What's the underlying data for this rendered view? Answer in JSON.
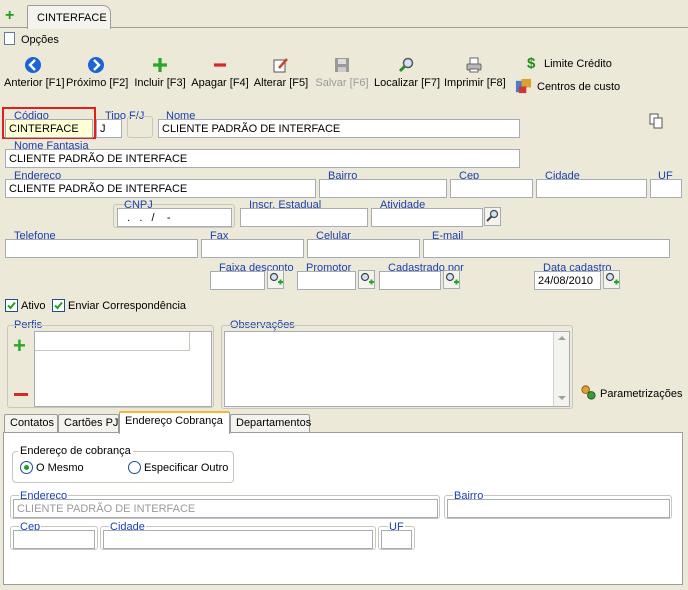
{
  "tab_title": "CINTERFACE",
  "menu": {
    "options": "Opções"
  },
  "toolbar": {
    "previous": "Anterior [F1]",
    "next": "Próximo [F2]",
    "add": "Incluir [F3]",
    "delete": "Apagar [F4]",
    "edit": "Alterar [F5]",
    "save": "Salvar [F6]",
    "find": "Localizar [F7]",
    "print": "Imprimir [F8]",
    "credit_limit": "Limite Crédito",
    "cost_centers": "Centros de custo"
  },
  "form": {
    "codigo": {
      "label": "Código",
      "value": "CINTERFACE"
    },
    "tipo": {
      "label": "Tipo F/J",
      "value": "J"
    },
    "nome": {
      "label": "Nome",
      "value": "CLIENTE PADRÃO DE INTERFACE"
    },
    "nome_fantasia": {
      "label": "Nome Fantasia",
      "value": "CLIENTE PADRÃO DE INTERFACE"
    },
    "endereco": {
      "label": "Endereço",
      "value": "CLIENTE PADRÃO DE INTERFACE"
    },
    "bairro": {
      "label": "Bairro",
      "value": ""
    },
    "cep": {
      "label": "Cep",
      "value": ""
    },
    "cidade": {
      "label": "Cidade",
      "value": ""
    },
    "uf": {
      "label": "UF",
      "value": ""
    },
    "cnpj": {
      "label": "CNPJ",
      "value": "  .   .   /    -  "
    },
    "inscr_estadual": {
      "label": "Inscr. Estadual",
      "value": ""
    },
    "atividade": {
      "label": "Atividade",
      "value": ""
    },
    "telefone": {
      "label": "Telefone",
      "value": ""
    },
    "fax": {
      "label": "Fax",
      "value": ""
    },
    "celular": {
      "label": "Celular",
      "value": ""
    },
    "email": {
      "label": "E-mail",
      "value": ""
    },
    "faixa_desconto": {
      "label": "Faixa desconto",
      "value": ""
    },
    "promotor": {
      "label": "Promotor",
      "value": ""
    },
    "cadastrado_por": {
      "label": "Cadastrado por",
      "value": ""
    },
    "data_cadastro": {
      "label": "Data cadastro",
      "value": "24/08/2010"
    },
    "ativo": {
      "label": "Ativo",
      "checked": true
    },
    "enviar_correspondencia": {
      "label": "Enviar Correspondência",
      "checked": true
    },
    "perfis": {
      "label": "Perfis"
    },
    "observacoes": {
      "label": "Observações"
    },
    "parametrizacoes": "Parametrizações"
  },
  "tabs": [
    "Contatos",
    "Cartões PJ",
    "Endereço Cobrança",
    "Departamentos"
  ],
  "active_tab": "Endereço Cobrança",
  "cobranca": {
    "group_label": "Endereço de cobrança",
    "option_same": "O Mesmo",
    "option_other": "Especificar Outro",
    "selected": "O Mesmo",
    "endereco": {
      "label": "Endereço",
      "value": "CLIENTE PADRÃO DE INTERFACE"
    },
    "bairro": {
      "label": "Bairro",
      "value": ""
    },
    "cep": {
      "label": "Cep",
      "value": ""
    },
    "cidade": {
      "label": "Cidade",
      "value": ""
    },
    "uf": {
      "label": "UF",
      "value": ""
    }
  },
  "colors": {
    "label_blue": "#1A3FB0",
    "highlight_red": "#E0201E",
    "code_bg": "#FFFFD6",
    "active_tab_accent": "#F5B631"
  }
}
